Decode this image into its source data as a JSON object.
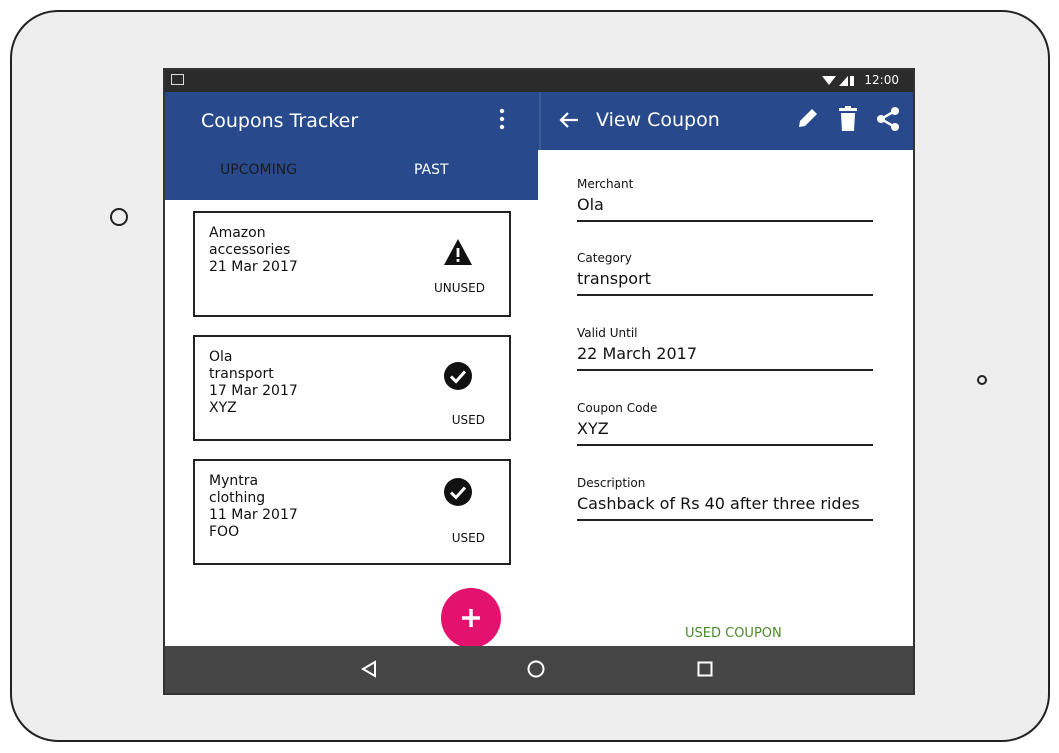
{
  "status_bar": {
    "time": "12:00"
  },
  "list_pane": {
    "title": "Coupons Tracker",
    "tabs": [
      {
        "label": "UPCOMING",
        "active": true
      },
      {
        "label": "PAST",
        "active": false
      }
    ],
    "coupons": [
      {
        "lines": [
          "Amazon",
          "accessories",
          "21 Mar 2017"
        ],
        "status": "UNUSED",
        "icon": "warning-icon"
      },
      {
        "lines": [
          "Ola",
          "transport",
          "17 Mar 2017",
          "XYZ"
        ],
        "status": "USED",
        "icon": "check-circle-icon"
      },
      {
        "lines": [
          "Myntra",
          "clothing",
          "11 Mar 2017",
          "FOO"
        ],
        "status": "USED",
        "icon": "check-circle-icon"
      }
    ]
  },
  "detail_pane": {
    "title": "View Coupon",
    "fields": [
      {
        "label": "Merchant",
        "value": "Ola"
      },
      {
        "label": "Category",
        "value": "transport"
      },
      {
        "label": "Valid Until",
        "value": "22 March 2017"
      },
      {
        "label": "Coupon Code",
        "value": "XYZ"
      },
      {
        "label": "Description",
        "value": "Cashback of Rs 40 after three rides"
      }
    ],
    "action_label": "USED COUPON"
  },
  "colors": {
    "app_bar": "#284a8c",
    "fab": "#e3126f",
    "used_action": "#4a8a2a",
    "nav_bar": "#454545"
  }
}
